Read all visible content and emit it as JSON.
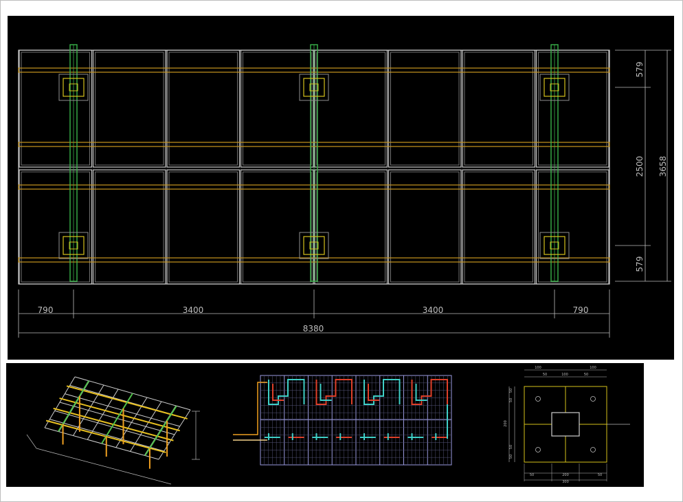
{
  "plan": {
    "panel_columns": 8,
    "panel_rows": 2,
    "support_columns": 3,
    "purlin_rows": 4,
    "dims_bottom": [
      "790",
      "3400",
      "3400",
      "790"
    ],
    "dim_total_width": "8380",
    "dims_right": [
      "579",
      "2500",
      "579"
    ],
    "dim_total_height": "3658"
  },
  "foundation": {
    "top_dims": [
      "100",
      "100",
      "50",
      "100",
      "50"
    ],
    "left_dims": [
      "50",
      "50",
      "200",
      "50",
      "50"
    ],
    "bottom_dims": [
      "50",
      "200",
      "50"
    ],
    "bottom_total": "300"
  },
  "colors": {
    "frame_line": "#c8c8c8",
    "purlin": "#c8961e",
    "post": "#39b54a",
    "base_plate": "#d6c21a",
    "wire_red": "#e0402a",
    "wire_cyan": "#3fd0c8",
    "wire_orange": "#f0a020"
  }
}
